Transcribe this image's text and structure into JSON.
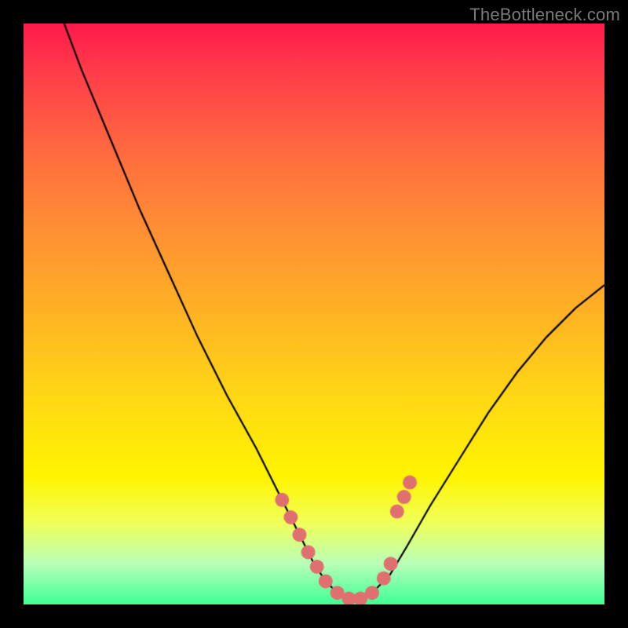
{
  "watermark": "TheBottleneck.com",
  "chart_data": {
    "type": "line",
    "title": "",
    "xlabel": "",
    "ylabel": "",
    "xlim": [
      0,
      100
    ],
    "ylim": [
      0,
      100
    ],
    "grid": false,
    "series": [
      {
        "name": "bottleneck-curve",
        "x": [
          7,
          10,
          15,
          20,
          25,
          30,
          35,
          40,
          45,
          48,
          50,
          52,
          54,
          56,
          58,
          60,
          63,
          66,
          70,
          75,
          80,
          85,
          90,
          95,
          100
        ],
        "y": [
          100,
          92,
          80,
          68,
          57,
          46,
          36,
          27,
          17,
          11,
          7,
          4,
          2,
          1,
          1,
          2,
          5,
          10,
          17,
          25,
          33,
          40,
          46,
          51,
          55
        ],
        "color": "#000000"
      }
    ],
    "markers": {
      "name": "highlight-dots",
      "color": "#e07070",
      "radius": 9,
      "x": [
        44.5,
        46.0,
        47.5,
        49.0,
        50.5,
        52.0,
        54.0,
        56.0,
        58.0,
        60.0,
        62.0,
        63.2,
        64.3,
        65.5,
        66.5
      ],
      "y": [
        18.0,
        15.0,
        12.0,
        9.0,
        6.5,
        4.0,
        2.0,
        1.0,
        1.0,
        2.0,
        4.5,
        7.0,
        16.0,
        18.5,
        21.0
      ]
    },
    "background_gradient": {
      "top": "#ff1a4d",
      "bottom": "#3fff95"
    }
  }
}
